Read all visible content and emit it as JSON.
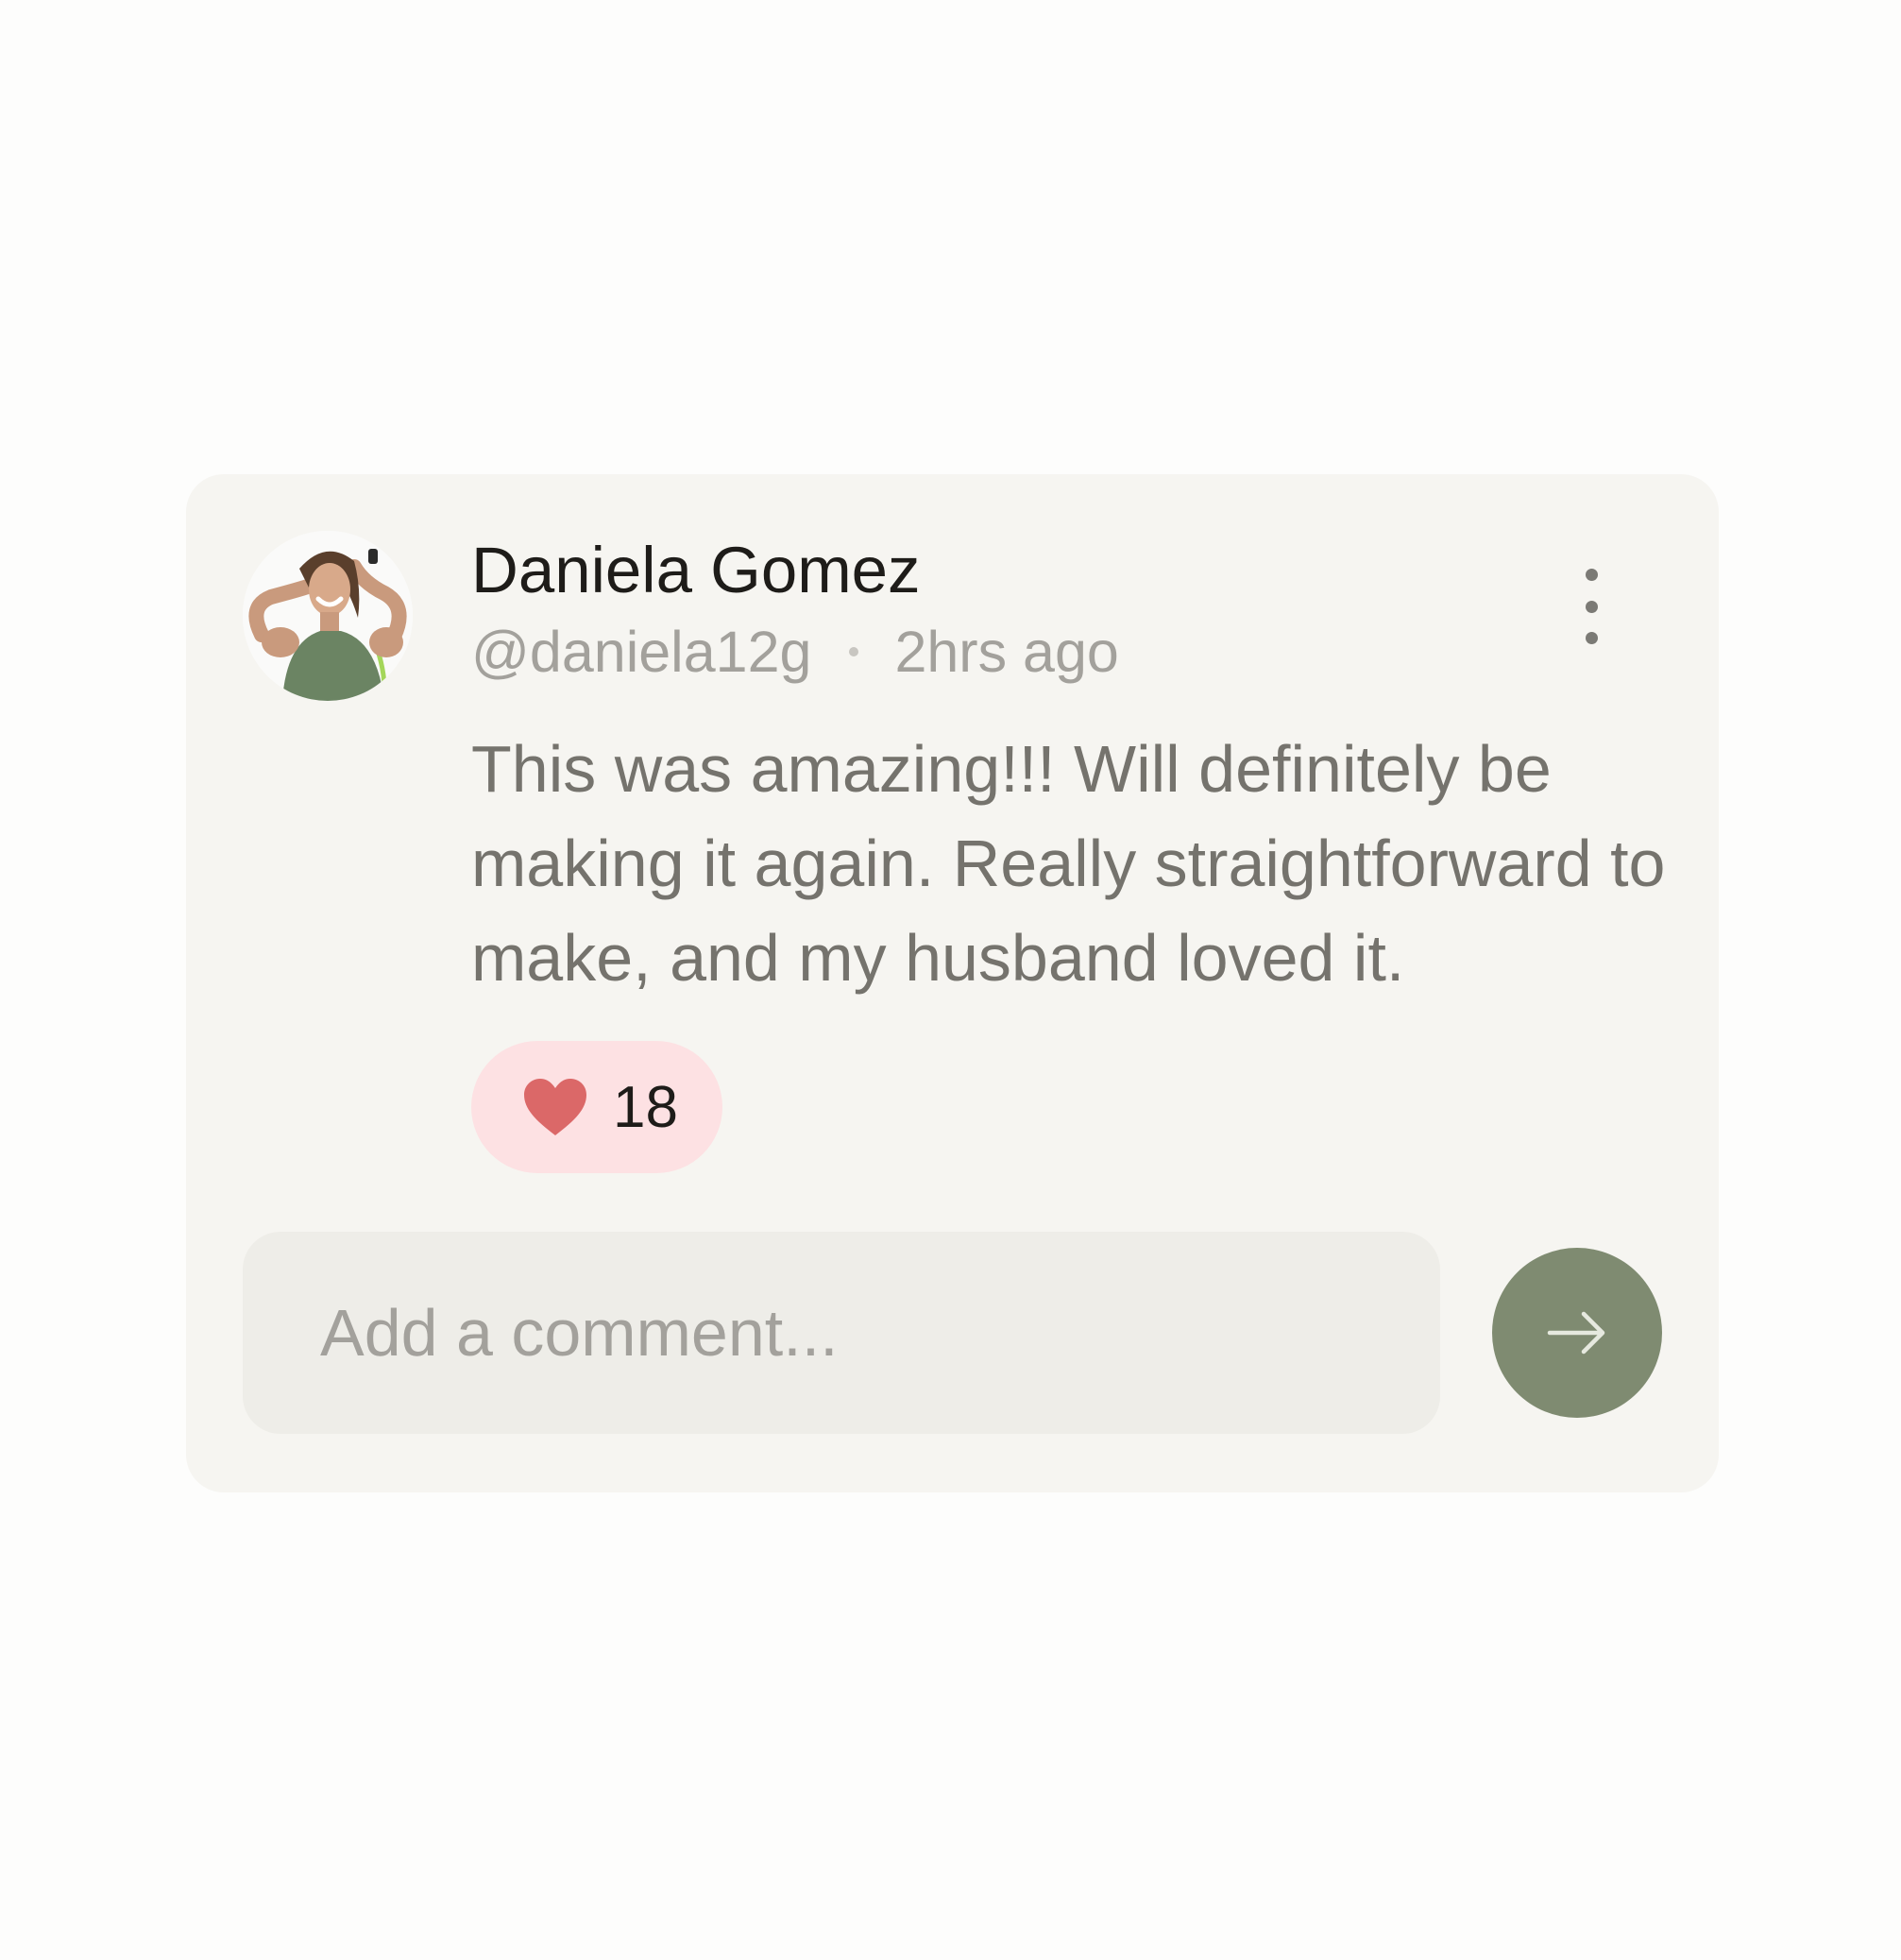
{
  "post": {
    "author_name": "Daniela Gomez",
    "handle": "@daniela12g",
    "time_ago": "2hrs ago",
    "body": "This was amazing!!! Will definitely be making it again. Really straightforward to make, and my husband loved it.",
    "avatar_icon": "user-photo-avatar"
  },
  "actions": {
    "more_icon": "more-vertical-icon",
    "like_icon": "heart-icon",
    "like_count": "18",
    "like_color": "#db6868",
    "like_bg": "#fde1e3"
  },
  "comment": {
    "placeholder": "Add a comment...",
    "value": "",
    "send_icon": "arrow-right-icon",
    "send_color": "#7f8b71"
  }
}
